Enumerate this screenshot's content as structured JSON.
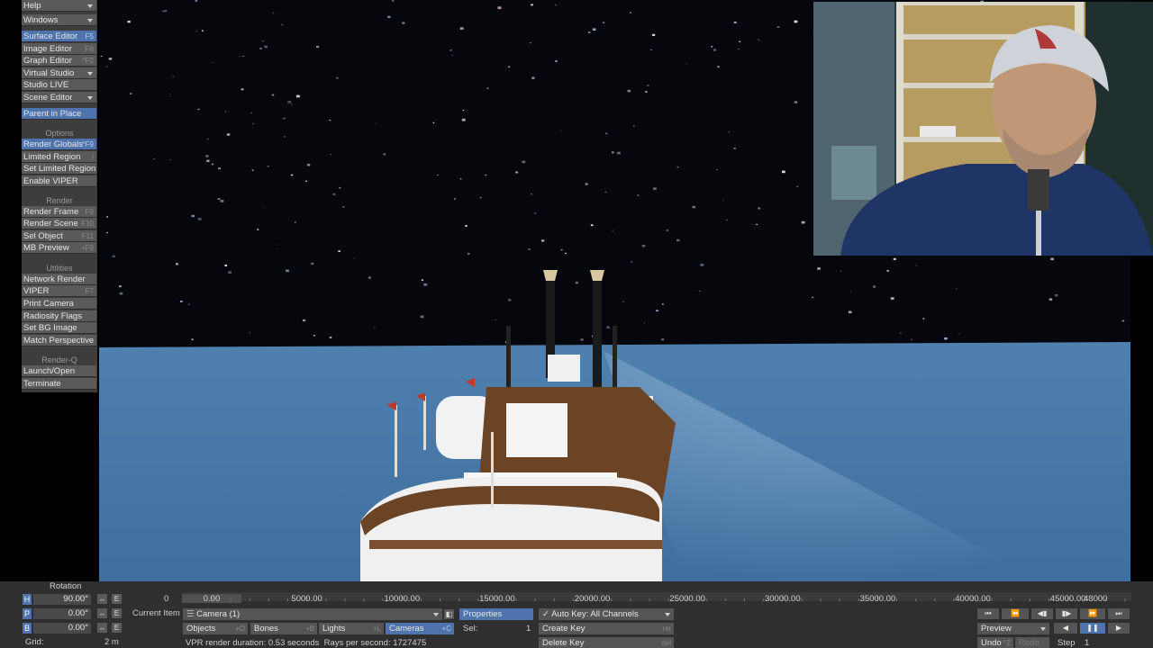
{
  "left_toolbar": {
    "top_menus": [
      {
        "label": "Help"
      },
      {
        "label": "Windows"
      }
    ],
    "window_items": [
      {
        "label": "Surface Editor",
        "shortcut": "F5",
        "highlight": true
      },
      {
        "label": "Image Editor",
        "shortcut": "F6"
      },
      {
        "label": "Graph Editor",
        "shortcut": "^F2"
      },
      {
        "label": "Virtual Studio",
        "dropdown": true
      },
      {
        "label": "Studio LIVE"
      },
      {
        "label": "Scene Editor",
        "dropdown": true
      }
    ],
    "parent_in_place": {
      "label": "Parent in Place",
      "active": true
    },
    "options_header": "Options",
    "options_items": [
      {
        "label": "Render Globals",
        "shortcut": "^F9",
        "highlight": true
      },
      {
        "label": "Limited Region",
        "shortcut": "l"
      },
      {
        "label": "Set Limited Region"
      },
      {
        "label": "Enable VIPER"
      }
    ],
    "render_header": "Render",
    "render_items": [
      {
        "label": "Render Frame",
        "shortcut": "F9"
      },
      {
        "label": "Render Scene",
        "shortcut": "F10"
      },
      {
        "label": "Sel Object",
        "shortcut": "F11"
      },
      {
        "label": "MB Preview",
        "shortcut": "+F9"
      }
    ],
    "utilities_header": "Utilities",
    "utilities_items": [
      {
        "label": "Network Render"
      },
      {
        "label": "VIPER",
        "shortcut": "F7"
      },
      {
        "label": "Print Camera"
      },
      {
        "label": "Radiosity Flags"
      },
      {
        "label": "Set BG Image"
      },
      {
        "label": "Match Perspective"
      }
    ],
    "renderq_header": "Render-Q",
    "renderq_items": [
      {
        "label": "Launch/Open"
      },
      {
        "label": "Terminate"
      }
    ]
  },
  "bottom_bar": {
    "rotation_title": "Rotation",
    "axes": [
      {
        "label": "H",
        "value": "90.00°"
      },
      {
        "label": "P",
        "value": "0.00°"
      },
      {
        "label": "B",
        "value": "0.00°"
      }
    ],
    "grid_label": "Grid:",
    "grid_value": "2 m",
    "current_item_label": "Current Item",
    "current_item_value": "Camera (1)",
    "properties_label": "Properties",
    "auto_key_label": "Auto Key: All Channels",
    "item_types": [
      {
        "label": "Objects",
        "shortcut": "+O"
      },
      {
        "label": "Bones",
        "shortcut": "+B"
      },
      {
        "label": "Lights",
        "shortcut": "+L"
      },
      {
        "label": "Cameras",
        "shortcut": "+C",
        "active": true
      }
    ],
    "sel_label": "Sel:",
    "sel_value": "1",
    "create_key": {
      "label": "Create Key",
      "shortcut": "ret"
    },
    "delete_key": {
      "label": "Delete Key",
      "shortcut": "del"
    },
    "status_text": "VPR render duration: 0.53 seconds  Rays per second: 1727475",
    "timeline_start": "0",
    "timeline_ticks": [
      "0.00",
      "5000.00",
      "10000.00",
      "15000.00",
      "20000.00",
      "25000.00",
      "30000.00",
      "35000.00",
      "40000.00",
      "45000.00"
    ],
    "timeline_end": "48000",
    "preview_label": "Preview",
    "undo_label": "Undo",
    "undo_shortcut": "^Z",
    "redo_label": "Redo",
    "step_label": "Step",
    "step_value": "1",
    "transport_icons": [
      "first-frame-icon",
      "prev-key-icon",
      "prev-frame-icon",
      "next-frame-icon",
      "next-key-icon",
      "last-frame-icon",
      "play-back-icon",
      "pause-icon",
      "play-icon"
    ]
  },
  "colors": {
    "accent": "#4f74ad",
    "panel": "#3d3d3d",
    "button": "#5a5a5a",
    "ocean": "#4a7aa6",
    "sky": "#05070d",
    "deck": "#6b4426"
  }
}
